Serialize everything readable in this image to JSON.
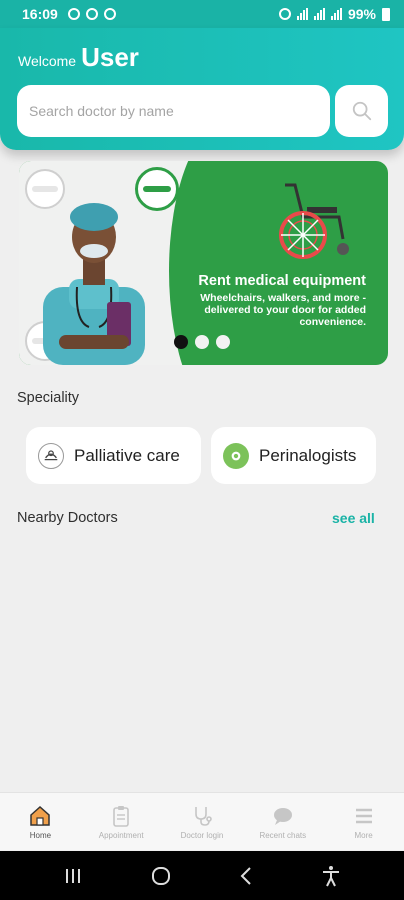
{
  "status_bar": {
    "time": "16:09",
    "battery": "99%"
  },
  "header": {
    "welcome": "Welcome",
    "user": "User",
    "search_placeholder": "Search doctor by name"
  },
  "banner": {
    "title": "Rent medical equipment",
    "subtitle": "Wheelchairs, walkers, and more - delivered to your door for added convenience.",
    "slide_count": 3,
    "active_slide": 1
  },
  "speciality": {
    "title": "Speciality",
    "items": [
      {
        "label": "Palliative care",
        "icon": "palliative-care-icon"
      },
      {
        "label": "Perinalogists",
        "icon": "perinatology-icon"
      }
    ]
  },
  "nearby": {
    "title": "Nearby Doctors",
    "see_all": "see all"
  },
  "bottom_nav": {
    "items": [
      {
        "label": "Home",
        "icon": "home-icon",
        "active": true
      },
      {
        "label": "Appointment",
        "icon": "clipboard-icon",
        "active": false
      },
      {
        "label": "Doctor login",
        "icon": "stethoscope-icon",
        "active": false
      },
      {
        "label": "Recent chats",
        "icon": "chat-icon",
        "active": false
      },
      {
        "label": "More",
        "icon": "menu-icon",
        "active": false
      }
    ]
  },
  "colors": {
    "primary": "#1ab3a6",
    "banner_green": "#2e9e46",
    "home_accent": "#f0a04b"
  }
}
